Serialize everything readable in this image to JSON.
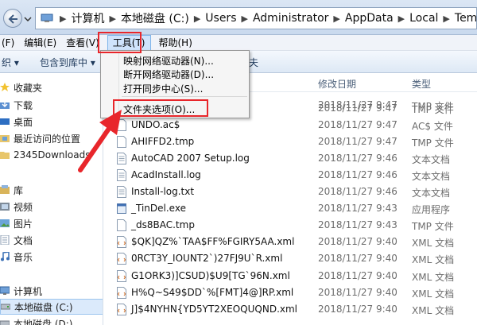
{
  "address": {
    "crumbs": [
      "计算机",
      "本地磁盘 (C:)",
      "Users",
      "Administrator",
      "AppData",
      "Local",
      "Temp"
    ]
  },
  "menubar": {
    "file": "(F)",
    "edit": "编辑(E)",
    "view": "查看(V)",
    "tools": "工具(T)",
    "help": "帮助(H)"
  },
  "toolbar": {
    "organize": "织 ▾",
    "include": "包含到库中 ▾",
    "share_tail": "夫"
  },
  "tools_menu": {
    "items": [
      "映射网络驱动器(N)...",
      "断开网络驱动器(D)...",
      "打开同步中心(S)...",
      "文件夹选项(O)..."
    ]
  },
  "nav": {
    "items": [
      "收藏夹",
      "下载",
      "桌面",
      "最近访问的位置",
      "2345Downloads",
      "库",
      "视频",
      "图片",
      "文档",
      "音乐",
      "计算机",
      "本地磁盘 (C:)",
      "本地磁盘 (D:)"
    ]
  },
  "columns": {
    "date": "修改日期",
    "type": "类型"
  },
  "files": [
    {
      "name": "",
      "date": "2018/11/27 9:47",
      "type": "TMP 文件"
    },
    {
      "name": "",
      "date": "2018/11/27 9:47",
      "type": "TMP 文件"
    },
    {
      "name": "UNDO.ac$",
      "date": "2018/11/27 9:47",
      "type": "AC$ 文件"
    },
    {
      "name": "AHIFFD2.tmp",
      "date": "2018/11/27 9:47",
      "type": "TMP 文件"
    },
    {
      "name": "AutoCAD 2007 Setup.log",
      "date": "2018/11/27 9:46",
      "type": "文本文档"
    },
    {
      "name": "AcadInstall.log",
      "date": "2018/11/27 9:46",
      "type": "文本文档"
    },
    {
      "name": "Install-log.txt",
      "date": "2018/11/27 9:46",
      "type": "文本文档"
    },
    {
      "name": "_TinDel.exe",
      "date": "2018/11/27 9:43",
      "type": "应用程序"
    },
    {
      "name": "_ds8BAC.tmp",
      "date": "2018/11/27 9:43",
      "type": "TMP 文件"
    },
    {
      "name": "$QK]QZ%`TAA$FF%FGIRY5AA.xml",
      "date": "2018/11/27 9:40",
      "type": "XML 文档"
    },
    {
      "name": "0RCT3Y_IOUNT2`)27FJ9U`R.xml",
      "date": "2018/11/27 9:40",
      "type": "XML 文档"
    },
    {
      "name": "G1ORK3)]CSUD)$U9[TG`96N.xml",
      "date": "2018/11/27 9:40",
      "type": "XML 文档"
    },
    {
      "name": "H%Q~S49$DD`%[FMT]4@]RP.xml",
      "date": "2018/11/27 9:40",
      "type": "XML 文档"
    },
    {
      "name": "J]$4NYHN{YD5YT2XEOQUQND.xml",
      "date": "2018/11/27 9:40",
      "type": "XML 文档"
    }
  ],
  "colors": {
    "highlight_red": "#e8262b",
    "address_bg": "#dbe6f4",
    "menu_active": "#cfe3fb"
  }
}
